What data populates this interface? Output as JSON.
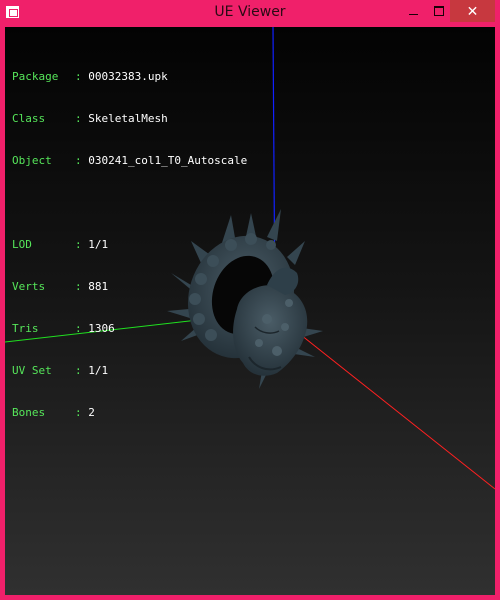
{
  "window": {
    "title": "UE Viewer",
    "controls": {
      "minimize": "minimize",
      "maximize": "maximize",
      "close": "✕"
    }
  },
  "info": {
    "object_rows": [
      {
        "label": "Package",
        "value": "00032383.upk"
      },
      {
        "label": "Class  ",
        "value": "SkeletalMesh"
      },
      {
        "label": "Object ",
        "value": "030241_col1_T0_Autoscale"
      }
    ],
    "mesh_rows": [
      {
        "label": "LOD    ",
        "value": "1/1"
      },
      {
        "label": "Verts  ",
        "value": "881"
      },
      {
        "label": "Tris   ",
        "value": "1306"
      },
      {
        "label": "UV Set ",
        "value": "1/1"
      },
      {
        "label": "Bones  ",
        "value": "2"
      }
    ]
  },
  "colors": {
    "frame": "#f0206a",
    "label": "#56e65a",
    "value": "#ffffff",
    "axis_x": "#ff2020",
    "axis_y": "#20e020",
    "axis_z": "#1020ff",
    "mesh": "#2e3f49"
  }
}
